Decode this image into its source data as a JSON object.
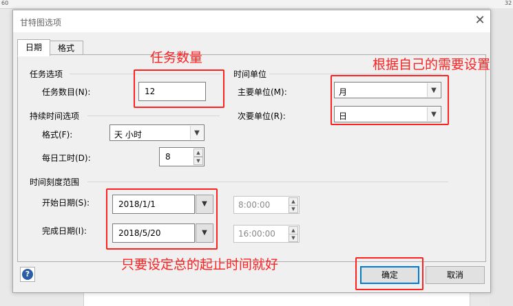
{
  "ruler": {
    "left": "60",
    "right": "32"
  },
  "dialog": {
    "title": "甘特图选项",
    "tabs": [
      {
        "label": "日期"
      },
      {
        "label": "格式"
      }
    ],
    "task_options": {
      "section": "任务选项",
      "task_count_label": "任务数目(N):",
      "task_count_value": "12"
    },
    "time_units": {
      "section": "时间单位",
      "major_label": "主要单位(M):",
      "major_value": "月",
      "minor_label": "次要单位(R):",
      "minor_value": "日"
    },
    "duration_options": {
      "section": "持续时间选项",
      "format_label": "格式(F):",
      "format_value": "天 小时",
      "hours_label": "每日工时(D):",
      "hours_value": "8"
    },
    "timescale": {
      "section": "时间刻度范围",
      "start_label": "开始日期(S):",
      "start_date": "2018/1/1",
      "start_time": "8:00:00",
      "finish_label": "完成日期(I):",
      "finish_date": "2018/5/20",
      "finish_time": "16:00:00"
    },
    "buttons": {
      "ok": "确定",
      "cancel": "取消",
      "help": "?"
    }
  },
  "annotations": {
    "task_count": "任务数量",
    "units": "根据自己的需要设置",
    "dates": "只要设定总的起止时间就好"
  },
  "colors": {
    "annotation": "#ff2020",
    "accent": "#0078d7"
  }
}
